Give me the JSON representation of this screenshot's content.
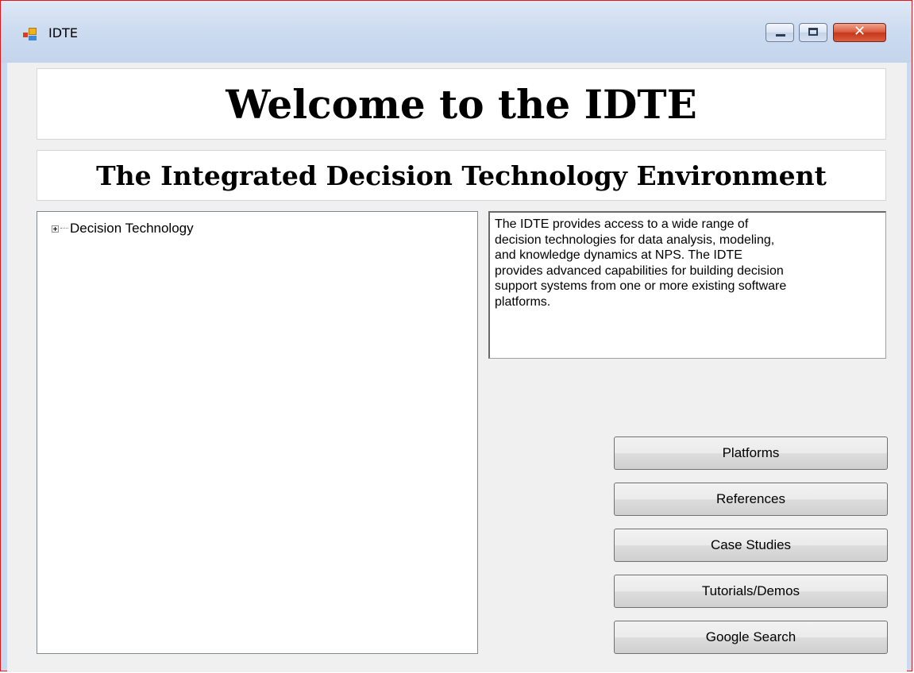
{
  "window": {
    "title": "IDTE",
    "close_glyph": "✕",
    "accent_color": "#e0181c"
  },
  "header": {
    "title": "Welcome to the IDTE",
    "subtitle": "The Integrated Decision Technology Environment"
  },
  "tree": {
    "nodes": [
      {
        "label": "Decision Technology",
        "expanded": false
      }
    ]
  },
  "description": {
    "text": "The IDTE provides access to a wide range of\ndecision technologies for data analysis, modeling,\nand knowledge dynamics at NPS.  The IDTE\nprovides advanced capabilities for building decision\nsupport systems from one or more existing software\nplatforms."
  },
  "buttons": [
    {
      "label": "Platforms"
    },
    {
      "label": "References"
    },
    {
      "label": "Case Studies"
    },
    {
      "label": "Tutorials/Demos"
    },
    {
      "label": "Google Search"
    }
  ]
}
